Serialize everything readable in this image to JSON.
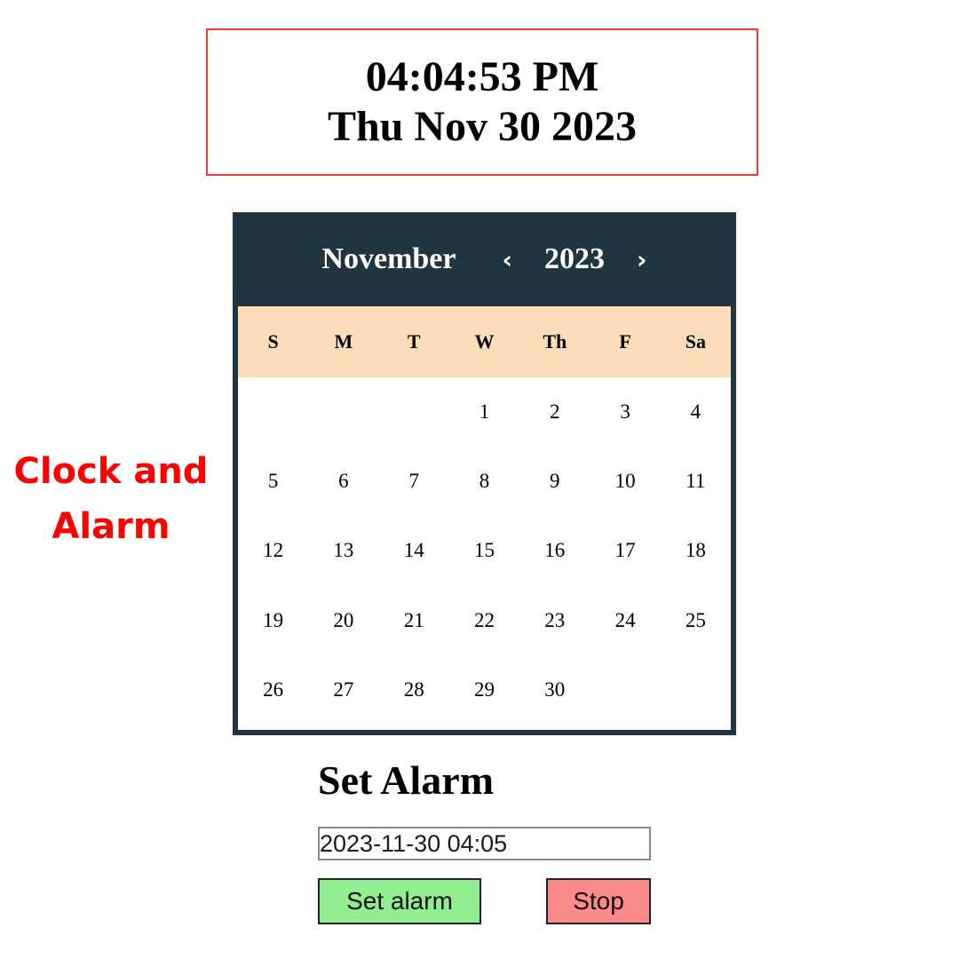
{
  "clock": {
    "time": "04:04:53 PM",
    "date": "Thu Nov 30 2023",
    "border_color": "#ef3b3b"
  },
  "side_label": {
    "line1": "Clock and",
    "line2": "Alarm",
    "color": "#ff0000"
  },
  "calendar": {
    "month": "November",
    "year": "2023",
    "prev_icon": "‹",
    "next_icon": "›",
    "header_color": "#1f3540",
    "weekday_bg": "#fadcb9",
    "weekdays": [
      "S",
      "M",
      "T",
      "W",
      "Th",
      "F",
      "Sa"
    ],
    "days": [
      "",
      "",
      "",
      "1",
      "2",
      "3",
      "4",
      "5",
      "6",
      "7",
      "8",
      "9",
      "10",
      "11",
      "12",
      "13",
      "14",
      "15",
      "16",
      "17",
      "18",
      "19",
      "20",
      "21",
      "22",
      "23",
      "24",
      "25",
      "26",
      "27",
      "28",
      "29",
      "30",
      "",
      ""
    ]
  },
  "alarm": {
    "title": "Set Alarm",
    "input_value": "2023-11-30 04:05",
    "set_label": "Set alarm",
    "stop_label": "Stop",
    "set_color": "#90ee90",
    "stop_color": "#fd8a8a"
  }
}
